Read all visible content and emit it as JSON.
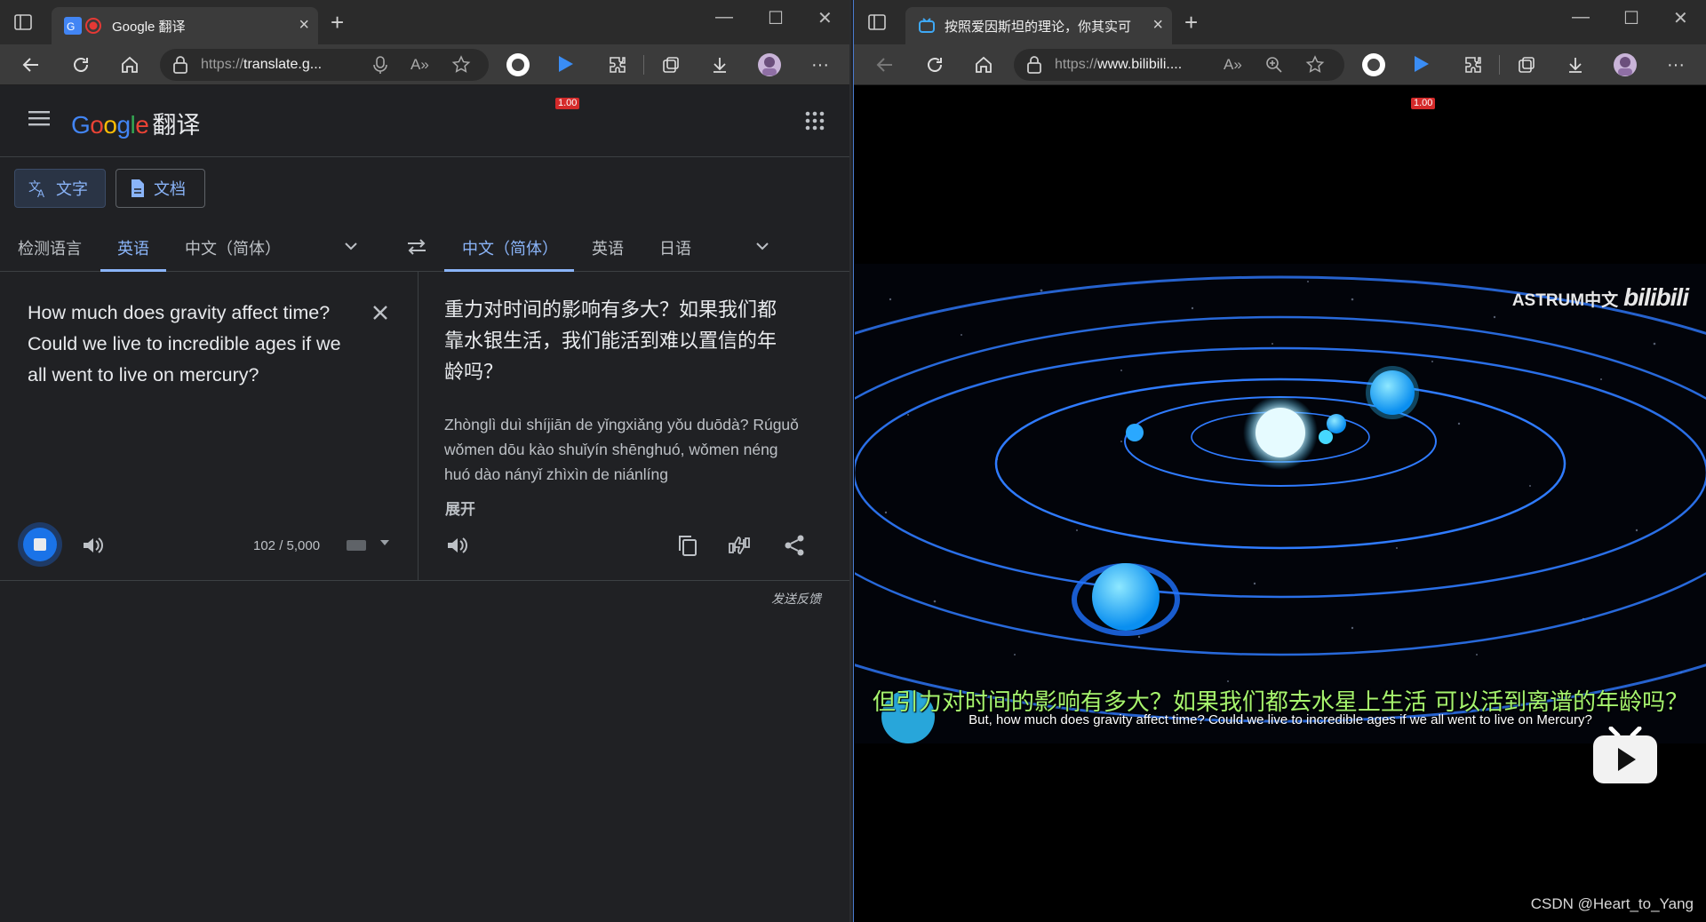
{
  "left_window": {
    "tab_title": "Google 翻译",
    "url_prefix": "https://",
    "url_domain": "translate.g...",
    "speed_badge": "1.00"
  },
  "right_window": {
    "tab_title": "按照爱因斯坦的理论，你其实可",
    "url_prefix": "https://",
    "url_domain": "www.bilibili....",
    "speed_badge": "1.00"
  },
  "translate": {
    "brand": "Google",
    "brand_suffix": "翻译",
    "mode_text": "文字",
    "mode_doc": "文档",
    "source_langs": [
      "检测语言",
      "英语",
      "中文（简体）"
    ],
    "target_langs": [
      "中文（简体）",
      "英语",
      "日语"
    ],
    "source_text": "How much does gravity affect time? Could we live to incredible ages if we all went to live on mercury?",
    "target_text": "重力对时间的影响有多大？如果我们都靠水银生活，我们能活到难以置信的年龄吗？",
    "pinyin": "Zhònglì duì shíjiān de yǐngxiǎng yǒu duōdà? Rúguǒ wǒmen dōu kào shuǐyín shēnghuó, wǒmen néng huó dào nányǐ zhìxìn de niánlíng",
    "expand_label": "展开",
    "char_count": "102 / 5,000",
    "feedback": "发送反馈"
  },
  "video": {
    "watermark": "ASTRUM中文",
    "watermark_logo": "bilibili",
    "subtitle_zh": "但引力对时间的影响有多大？如果我们都去水星上生活 可以活到离谱的年龄吗？",
    "subtitle_en": "But, how much does gravity affect time? Could we live to incredible ages if we all went to live on Mercury?",
    "credit": "CSDN @Heart_to_Yang"
  },
  "colors": {
    "accent_blue": "#8ab4f8",
    "subtitle_green": "#a6f46e",
    "orbit_blue": "#2f7bff"
  }
}
